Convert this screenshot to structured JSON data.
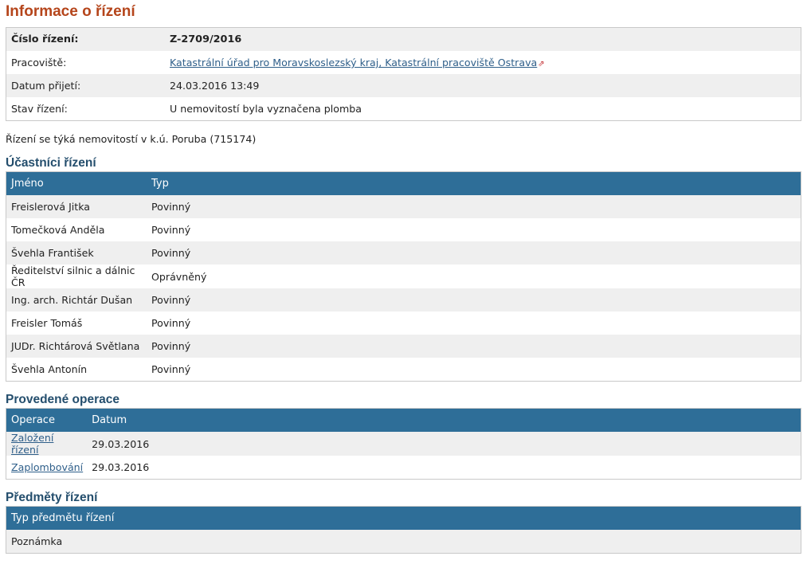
{
  "title": "Informace o řízení",
  "info": {
    "rows": [
      {
        "label": "Číslo řízení:",
        "value": "Z-2709/2016"
      },
      {
        "label": "Pracoviště:",
        "value": "Katastrální úřad pro Moravskoslezský kraj, Katastrální pracoviště Ostrava"
      },
      {
        "label": "Datum přijetí:",
        "value": "24.03.2016 13:49"
      },
      {
        "label": "Stav řízení:",
        "value": "U nemovitostí byla vyznačena plomba"
      }
    ]
  },
  "note": "Řízení se týká nemovitostí v k.ú. Poruba (715174)",
  "participants": {
    "heading": "Účastníci řízení",
    "columns": [
      "Jméno",
      "Typ"
    ],
    "rows": [
      [
        "Freislerová Jitka",
        "Povinný"
      ],
      [
        "Tomečková Anděla",
        "Povinný"
      ],
      [
        "Švehla František",
        "Povinný"
      ],
      [
        "Ředitelství silnic a dálnic ČR",
        "Oprávněný"
      ],
      [
        "Ing. arch. Richtár Dušan",
        "Povinný"
      ],
      [
        "Freisler Tomáš",
        "Povinný"
      ],
      [
        "JUDr. Richtárová Světlana",
        "Povinný"
      ],
      [
        "Švehla Antonín",
        "Povinný"
      ]
    ]
  },
  "operations": {
    "heading": "Provedené operace",
    "columns": [
      "Operace",
      "Datum"
    ],
    "rows": [
      [
        "Založení řízení",
        "29.03.2016"
      ],
      [
        "Zaplombování",
        "29.03.2016"
      ]
    ]
  },
  "subjects": {
    "heading": "Předměty řízení",
    "columns": [
      "Typ předmětu řízení"
    ],
    "rows": [
      [
        "Poznámka"
      ]
    ]
  },
  "colors": {
    "title": "#b5451b",
    "heading": "#244e6d",
    "table_header": "#2e6e98",
    "link": "#2f5f8a"
  },
  "icons": {
    "external_link": "external-link-icon"
  }
}
